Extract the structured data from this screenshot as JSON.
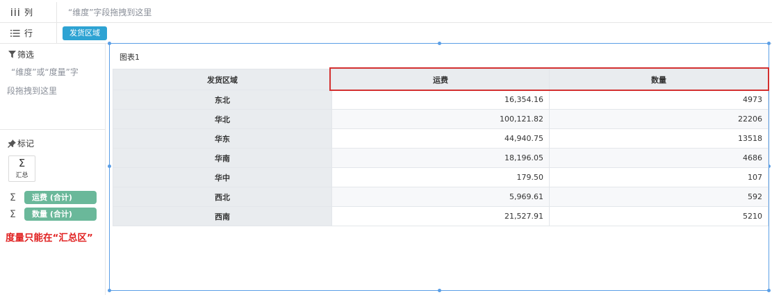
{
  "shelves": {
    "column": {
      "label": "列",
      "placeholder": "“维度”字段拖拽到这里"
    },
    "row": {
      "label": "行",
      "pill": "发货区域"
    }
  },
  "filter": {
    "title": "筛选",
    "hint_line1": "“维度”或“度量”字",
    "hint_line2": "段拖拽到这里"
  },
  "marks": {
    "title": "标记",
    "summary_label": "汇总",
    "measures": [
      "运费 (合计)",
      "数量 (合计)"
    ]
  },
  "annotation": "度量只能在“汇总区”",
  "chart": {
    "title": "图表1",
    "columns": [
      "发货区域",
      "运费",
      "数量"
    ],
    "rows": [
      {
        "region": "东北",
        "freight": "16,354.16",
        "qty": "4973"
      },
      {
        "region": "华北",
        "freight": "100,121.82",
        "qty": "22206"
      },
      {
        "region": "华东",
        "freight": "44,940.75",
        "qty": "13518"
      },
      {
        "region": "华南",
        "freight": "18,196.05",
        "qty": "4686"
      },
      {
        "region": "华中",
        "freight": "179.50",
        "qty": "107"
      },
      {
        "region": "西北",
        "freight": "5,969.61",
        "qty": "592"
      },
      {
        "region": "西南",
        "freight": "21,527.91",
        "qty": "5210"
      }
    ]
  },
  "colors": {
    "row_pill": "#2ea3d3",
    "measure_pill": "#6ab89a",
    "selection": "#5a9ee6",
    "highlight": "#d32f2f",
    "annotation": "#e02020"
  },
  "icons": {
    "column": "columns-icon",
    "row": "rows-icon",
    "filter": "funnel-icon",
    "marks": "pin-icon",
    "summary": "sigma-icon"
  }
}
